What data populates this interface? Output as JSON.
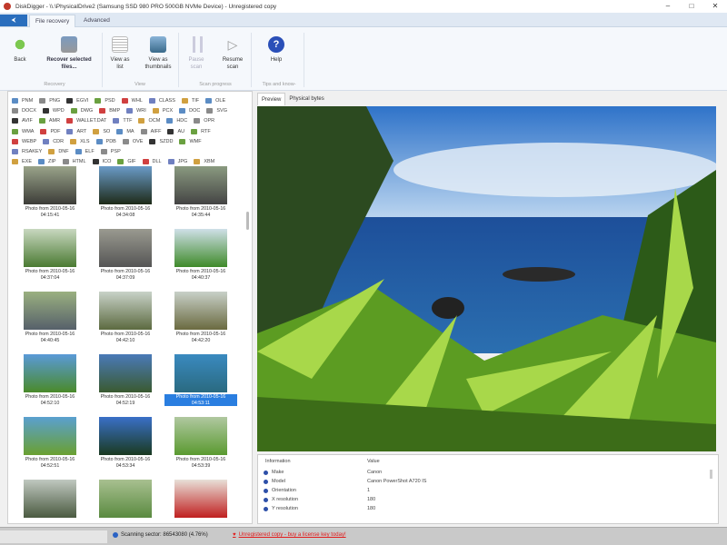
{
  "window": {
    "title": "DiskDigger - \\\\.\\PhysicalDrive2 (Samsung SSD 980 PRO 500GB NVMe Device) - Unregistered copy",
    "controls": [
      "–",
      "□",
      "✕"
    ]
  },
  "tabs": {
    "file_button": "⮜",
    "items": [
      "File recovery",
      "Advanced"
    ],
    "active": 0
  },
  "ribbon": {
    "back": "Back",
    "recover": "Recover selected files...",
    "view_list": "View as list",
    "view_thumbs": "View as thumbnails",
    "pause": "Pause scan",
    "resume": "Resume scan",
    "help": "Help",
    "groups": [
      "Recovery",
      "View",
      "Scan progress",
      "Tips and know-"
    ]
  },
  "file_types": [
    [
      "PNM",
      "PNG",
      "EGVI",
      "PSD",
      "WHL",
      "CLASS",
      "TIF",
      "OLE"
    ],
    [
      "DOCX",
      "WPD",
      "DWG",
      "BMP",
      "WRI",
      "PCX",
      "DOC",
      "SVG"
    ],
    [
      "AVIF",
      "AMR",
      "WALLET.DAT",
      "TTF",
      "OCM",
      "HDC",
      "OPR"
    ],
    [
      "WMA",
      "PDF",
      "ART",
      "SO",
      "MA",
      "AIFF",
      "AU",
      "RTF"
    ],
    [
      "WEBP",
      "CDR",
      "XLS",
      "PDB",
      "OVE",
      "SZDD",
      "WMF"
    ],
    [
      "RSAKEY",
      "DNF",
      "ELF",
      "PSP"
    ],
    [
      "EXE",
      "ZIP",
      "HTML",
      "ICO",
      "GIF",
      "DLL",
      "JPG",
      "XBM"
    ]
  ],
  "thumbnails": [
    {
      "caption": "Photo from 2010-05-16 04:15:41",
      "colors": [
        "#9aa48a",
        "#3c3c38"
      ]
    },
    {
      "caption": "Photo from 2010-05-16 04:34:08",
      "colors": [
        "#6a9bc8",
        "#1e2a18"
      ]
    },
    {
      "caption": "Photo from 2010-05-16 04:35:44",
      "colors": [
        "#8a9a80",
        "#444"
      ]
    },
    {
      "caption": "Photo from 2010-05-16 04:37:04",
      "colors": [
        "#c8d8c0",
        "#4a7a32"
      ]
    },
    {
      "caption": "Photo from 2010-05-16 04:37:09",
      "colors": [
        "#9a9a90",
        "#555"
      ]
    },
    {
      "caption": "Photo from 2010-05-16 04:40:37",
      "colors": [
        "#cfe0e8",
        "#3f8a2a"
      ]
    },
    {
      "caption": "Photo from 2010-05-16 04:40:45",
      "colors": [
        "#9ab080",
        "#56606a"
      ]
    },
    {
      "caption": "Photo from 2010-05-16 04:42:10",
      "colors": [
        "#c8d2c8",
        "#5c6a40"
      ]
    },
    {
      "caption": "Photo from 2010-05-16 04:42:20",
      "colors": [
        "#c8d0c8",
        "#6a6a40"
      ]
    },
    {
      "caption": "Photo from 2010-05-16 04:52:10",
      "colors": [
        "#5a9ad8",
        "#4a8a2a"
      ]
    },
    {
      "caption": "Photo from 2010-05-16 04:52:19",
      "colors": [
        "#4a7ab8",
        "#3a5a30"
      ]
    },
    {
      "caption": "Photo from 2010-05-16 04:53:11",
      "colors": [
        "#3a8ac0",
        "#2a6a80"
      ],
      "selected": true
    },
    {
      "caption": "Photo from 2010-05-16 04:52:51",
      "colors": [
        "#5aa0d0",
        "#6aa030"
      ]
    },
    {
      "caption": "Photo from 2010-05-16 04:53:34",
      "colors": [
        "#3a70c8",
        "#1a3a20"
      ]
    },
    {
      "caption": "Photo from 2010-05-16 04:53:39",
      "colors": [
        "#b0c8a0",
        "#5a9a30"
      ]
    },
    {
      "caption": "",
      "colors": [
        "#c0c8c0",
        "#4a5a40"
      ]
    },
    {
      "caption": "",
      "colors": [
        "#a8c090",
        "#5a8a40"
      ]
    },
    {
      "caption": "",
      "colors": [
        "#e8e0d8",
        "#c02020"
      ]
    }
  ],
  "preview": {
    "tabs": [
      "Preview",
      "Physical bytes"
    ],
    "active": 0
  },
  "info": {
    "headers": [
      "Information",
      "Value"
    ],
    "rows": [
      {
        "name": "Make",
        "value": "Canon"
      },
      {
        "name": "Model",
        "value": "Canon PowerShot A720 IS"
      },
      {
        "name": "Orientation",
        "value": "1"
      },
      {
        "name": "X resolution",
        "value": "180"
      },
      {
        "name": "Y resolution",
        "value": "180"
      }
    ]
  },
  "status": {
    "scan": "Scanning sector: 86543080 (4.76%)",
    "license": "Unregistered copy - buy a license key today!"
  },
  "colors": {
    "accent": "#2a6ebd",
    "selection": "#2a7ee0",
    "license": "#e21b1b"
  }
}
